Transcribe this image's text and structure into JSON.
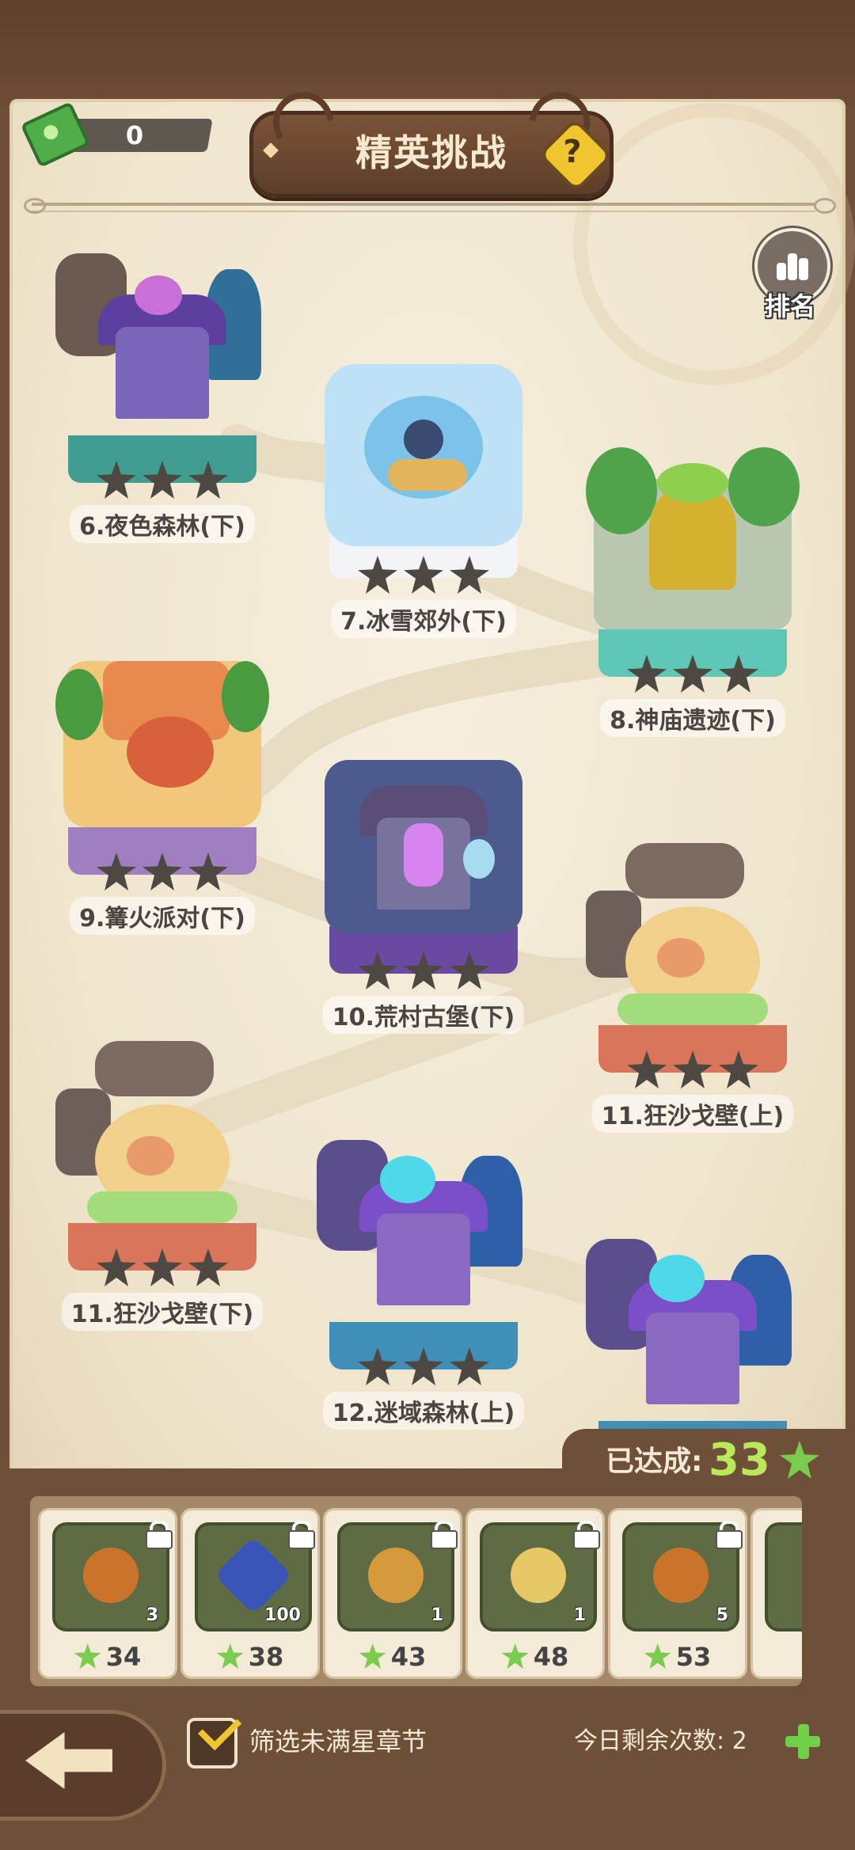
{
  "header": {
    "ticket_count": "0",
    "title": "精英挑战",
    "help_glyph": "?",
    "rank_label": "排名"
  },
  "levels": [
    {
      "label": "6.夜色森林(下)",
      "stars": 3,
      "theme": "haunted-forest"
    },
    {
      "label": "7.冰雪郊外(下)",
      "stars": 3,
      "theme": "snow"
    },
    {
      "label": "8.神庙遗迹(下)",
      "stars": 3,
      "theme": "temple"
    },
    {
      "label": "9.篝火派对(下)",
      "stars": 3,
      "theme": "campfire"
    },
    {
      "label": "10.荒村古堡(下)",
      "stars": 3,
      "theme": "castle"
    },
    {
      "label": "11.狂沙戈壁(上)",
      "stars": 3,
      "theme": "desert"
    },
    {
      "label": "11.狂沙戈壁(下)",
      "stars": 3,
      "theme": "desert"
    },
    {
      "label": "12.迷域森林(上)",
      "stars": 3,
      "theme": "mystic-forest"
    },
    {
      "label": "",
      "stars": 0,
      "theme": "mystic-forest"
    }
  ],
  "progress": {
    "label": "已达成:",
    "value": "33"
  },
  "rewards": [
    {
      "item": "potion-icon",
      "count": "3",
      "cost": "34",
      "locked": true
    },
    {
      "item": "gem-icon",
      "count": "100",
      "cost": "38",
      "locked": true
    },
    {
      "item": "mystery-flower-icon",
      "count": "1",
      "cost": "43",
      "locked": true
    },
    {
      "item": "leaf-scroll-icon",
      "count": "1",
      "cost": "48",
      "locked": true
    },
    {
      "item": "potion-icon",
      "count": "5",
      "cost": "53",
      "locked": true
    }
  ],
  "footer": {
    "filter_label": "筛选未满星章节",
    "filter_checked": true,
    "remaining_label": "今日剩余次数: 2"
  },
  "colors": {
    "frame_brown": "#6e4f38",
    "parchment": "#f6efdf",
    "star_green": "#79cc4e",
    "progress_green": "#b9e85a",
    "help_yellow": "#f0c52e"
  }
}
